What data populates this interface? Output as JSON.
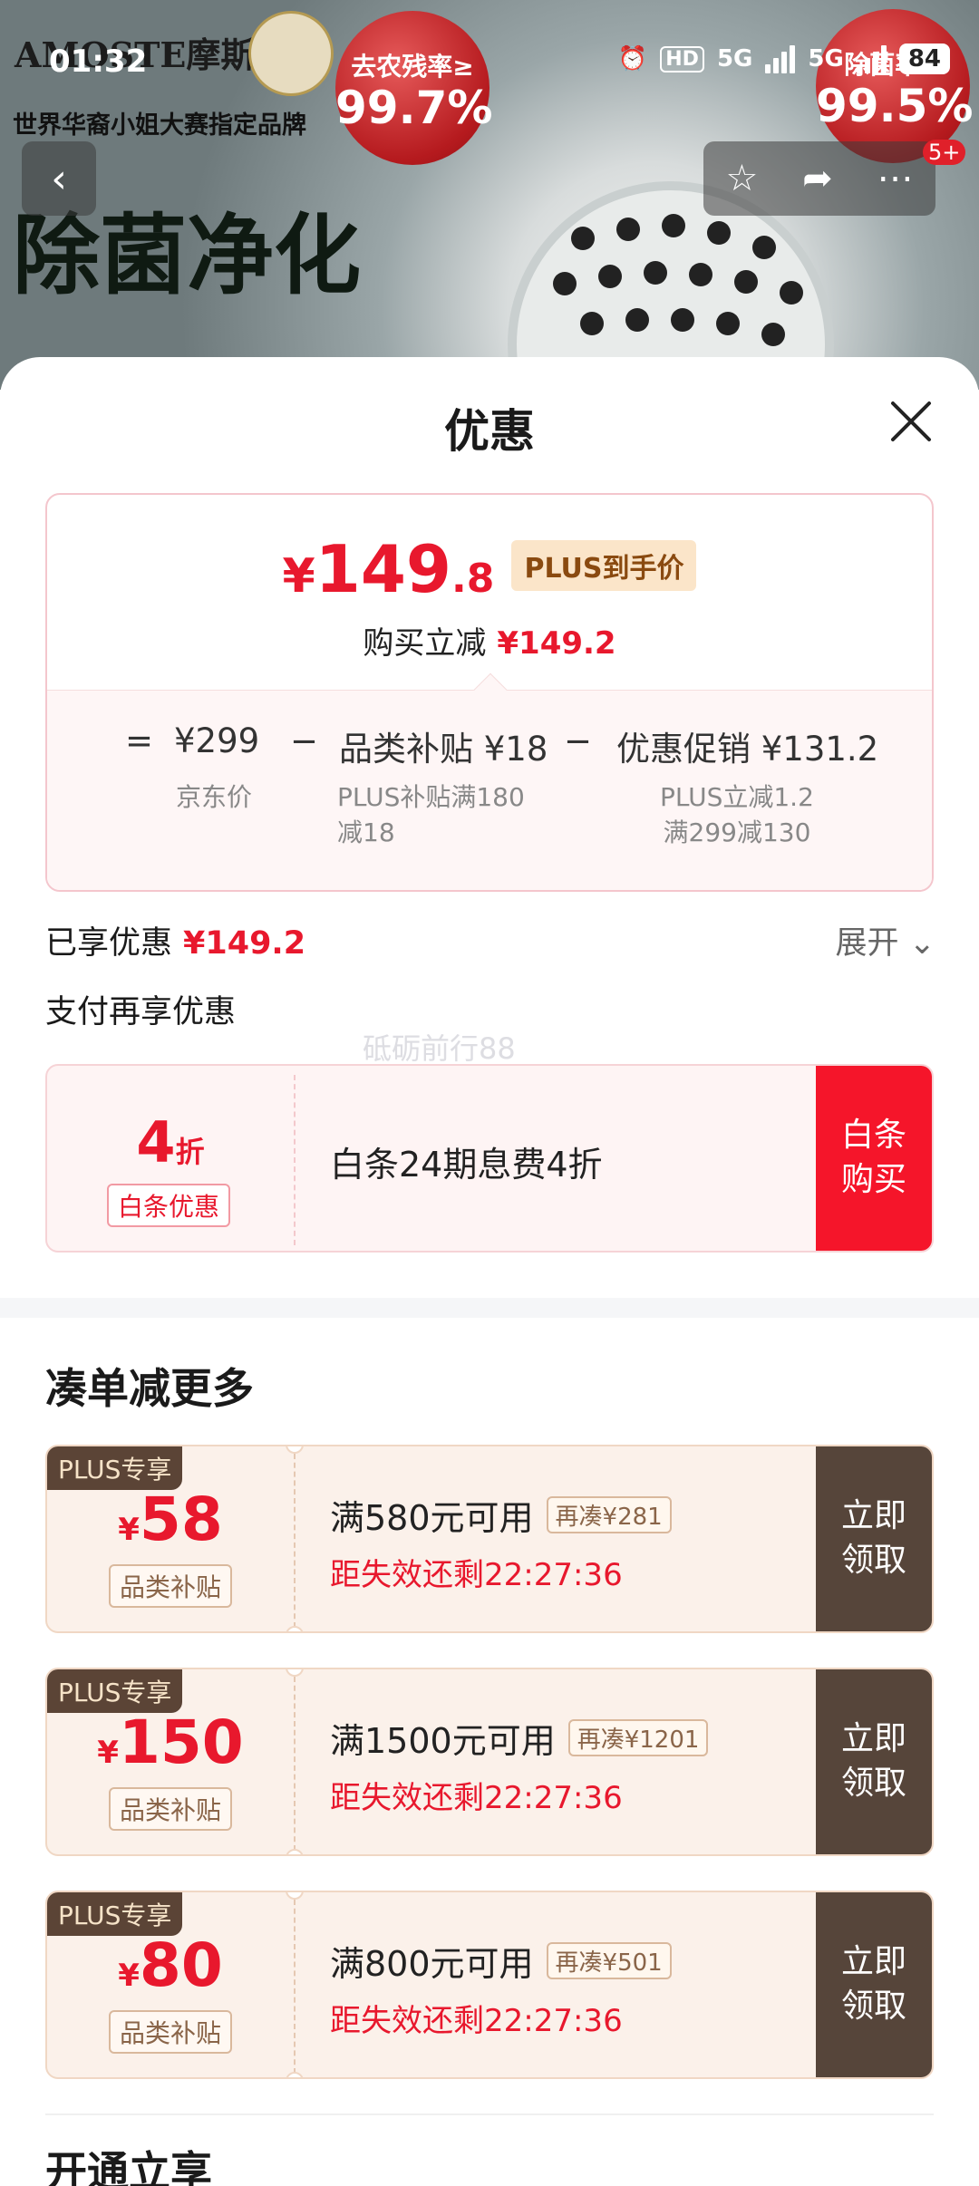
{
  "status_bar": {
    "time": "01:32",
    "hd": "HD",
    "net1": "5G",
    "net2": "5G",
    "battery": "84"
  },
  "background": {
    "brand": "AMOSTE摩斯",
    "tagline": "世界华裔小姐大赛指定品牌",
    "headline": "除菌净化",
    "badge1_line1": "去农残率≥",
    "badge1_line2": "99.7%",
    "badge2_line1": "除菌率≥",
    "badge2_line2": "99.5%"
  },
  "header": {
    "more_count": "5+"
  },
  "sheet": {
    "title": "优惠"
  },
  "price_card": {
    "yen": "¥",
    "price_int": "149",
    "price_dec": ".8",
    "plus_tag": "PLUS到手价",
    "reduce_label": "购买立减",
    "reduce_value": "¥149.2",
    "eq": "=",
    "jd_price": "¥299",
    "jd_label": "京东价",
    "minus1": "−",
    "subsidy": "品类补贴 ¥18",
    "subsidy_line1": "PLUS补贴满180",
    "subsidy_line2": "减18",
    "minus2": "−",
    "promo": "优惠促销 ¥131.2",
    "promo_line1": "PLUS立减1.2",
    "promo_line2": "满299减130"
  },
  "enjoyed": {
    "label": "已享优惠",
    "value": "¥149.2",
    "expand": "展开"
  },
  "pay_more": "支付再享优惠",
  "watermark": "砥砺前行88",
  "baitiao": {
    "discount_num": "4",
    "discount_unit": "折",
    "tag": "白条优惠",
    "desc": "白条24期息费4折",
    "buy_line1": "白条",
    "buy_line2": "购买"
  },
  "section_title": "凑单减更多",
  "coupons": [
    {
      "plus": "PLUS专享",
      "yen": "¥",
      "amount": "58",
      "tag": "品类补贴",
      "cond": "满580元可用",
      "need": "再凑¥281",
      "timer": "距失效还剩22:27:36",
      "claim1": "立即",
      "claim2": "领取"
    },
    {
      "plus": "PLUS专享",
      "yen": "¥",
      "amount": "150",
      "tag": "品类补贴",
      "cond": "满1500元可用",
      "need": "再凑¥1201",
      "timer": "距失效还剩22:27:36",
      "claim1": "立即",
      "claim2": "领取"
    },
    {
      "plus": "PLUS专享",
      "yen": "¥",
      "amount": "80",
      "tag": "品类补贴",
      "cond": "满800元可用",
      "need": "再凑¥501",
      "timer": "距失效还剩22:27:36",
      "claim1": "立即",
      "claim2": "领取"
    }
  ],
  "bottom_title": "开通立享",
  "colors": {
    "accent_red": "#e8182d",
    "coupon_dark": "#56453a"
  }
}
